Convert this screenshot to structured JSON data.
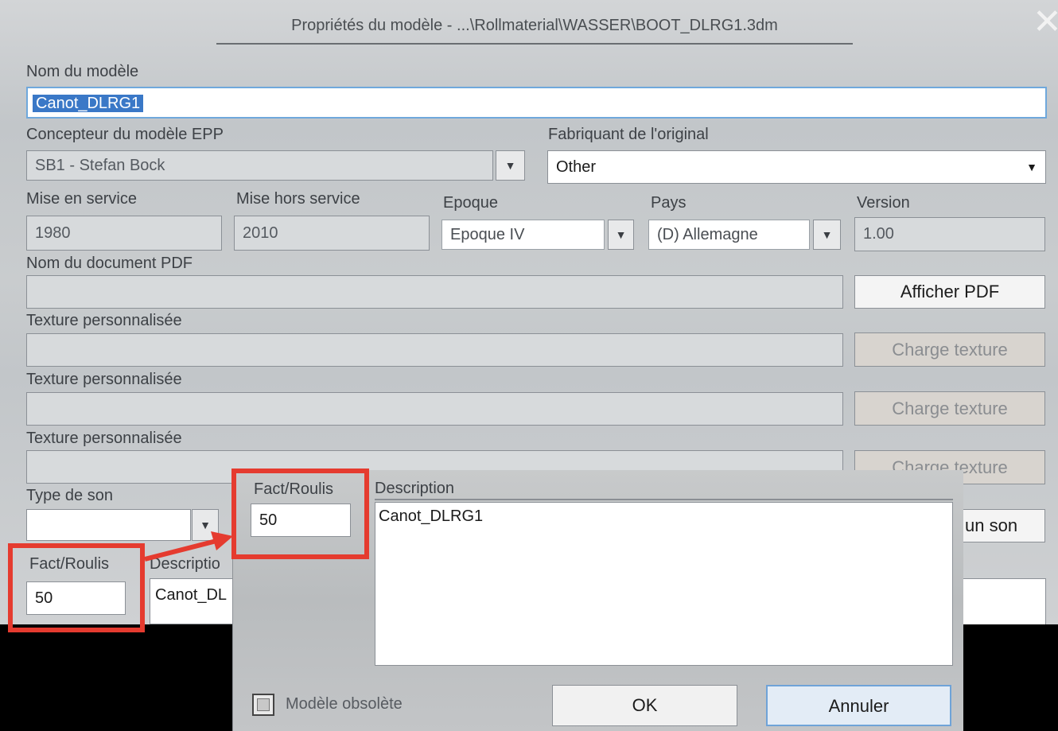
{
  "window": {
    "title": "Propriétés du modèle - ...\\Rollmaterial\\WASSER\\BOOT_DLRG1.3dm",
    "close_symbol": "✕"
  },
  "form": {
    "model_name_label": "Nom du modèle",
    "model_name_value": "Canot_DLRG1",
    "designer_label": "Concepteur du modèle EPP",
    "designer_value": "SB1 - Stefan Bock",
    "manufacturer_label": "Fabriquant de l'original",
    "manufacturer_value": "Other",
    "service_start_label": "Mise en service",
    "service_start_value": "1980",
    "service_end_label": "Mise hors service",
    "service_end_value": "2010",
    "epoch_label": "Epoque",
    "epoch_value": "Epoque IV",
    "country_label": "Pays",
    "country_value": "(D) Allemagne",
    "version_label": "Version",
    "version_value": "1.00",
    "pdf_label": "Nom du document PDF",
    "pdf_value": "",
    "pdf_button": "Afficher PDF",
    "texture_label_1": "Texture personnalisée",
    "texture_label_2": "Texture personnalisée",
    "texture_label_3": "Texture personnalisée",
    "texture_button_1": "Charge texture",
    "texture_button_2": "Charge texture",
    "texture_button_3": "Charge texture",
    "sound_type_label": "Type de son",
    "sound_type_value": "",
    "sound_button_partial": "un son",
    "fact_roulis_label": "Fact/Roulis",
    "fact_roulis_value": "50",
    "description_label_partial": "Descriptio",
    "description_value_partial": "Canot_DL"
  },
  "zoom_popup": {
    "fact_roulis_label": "Fact/Roulis",
    "fact_roulis_value": "50",
    "description_label": "Description",
    "description_value": "Canot_DLRG1",
    "obsolete_label": "Modèle obsolète",
    "ok_button": "OK",
    "cancel_button": "Annuler"
  },
  "colors": {
    "highlight": "#e53b2f",
    "selection": "#3a78c7"
  }
}
